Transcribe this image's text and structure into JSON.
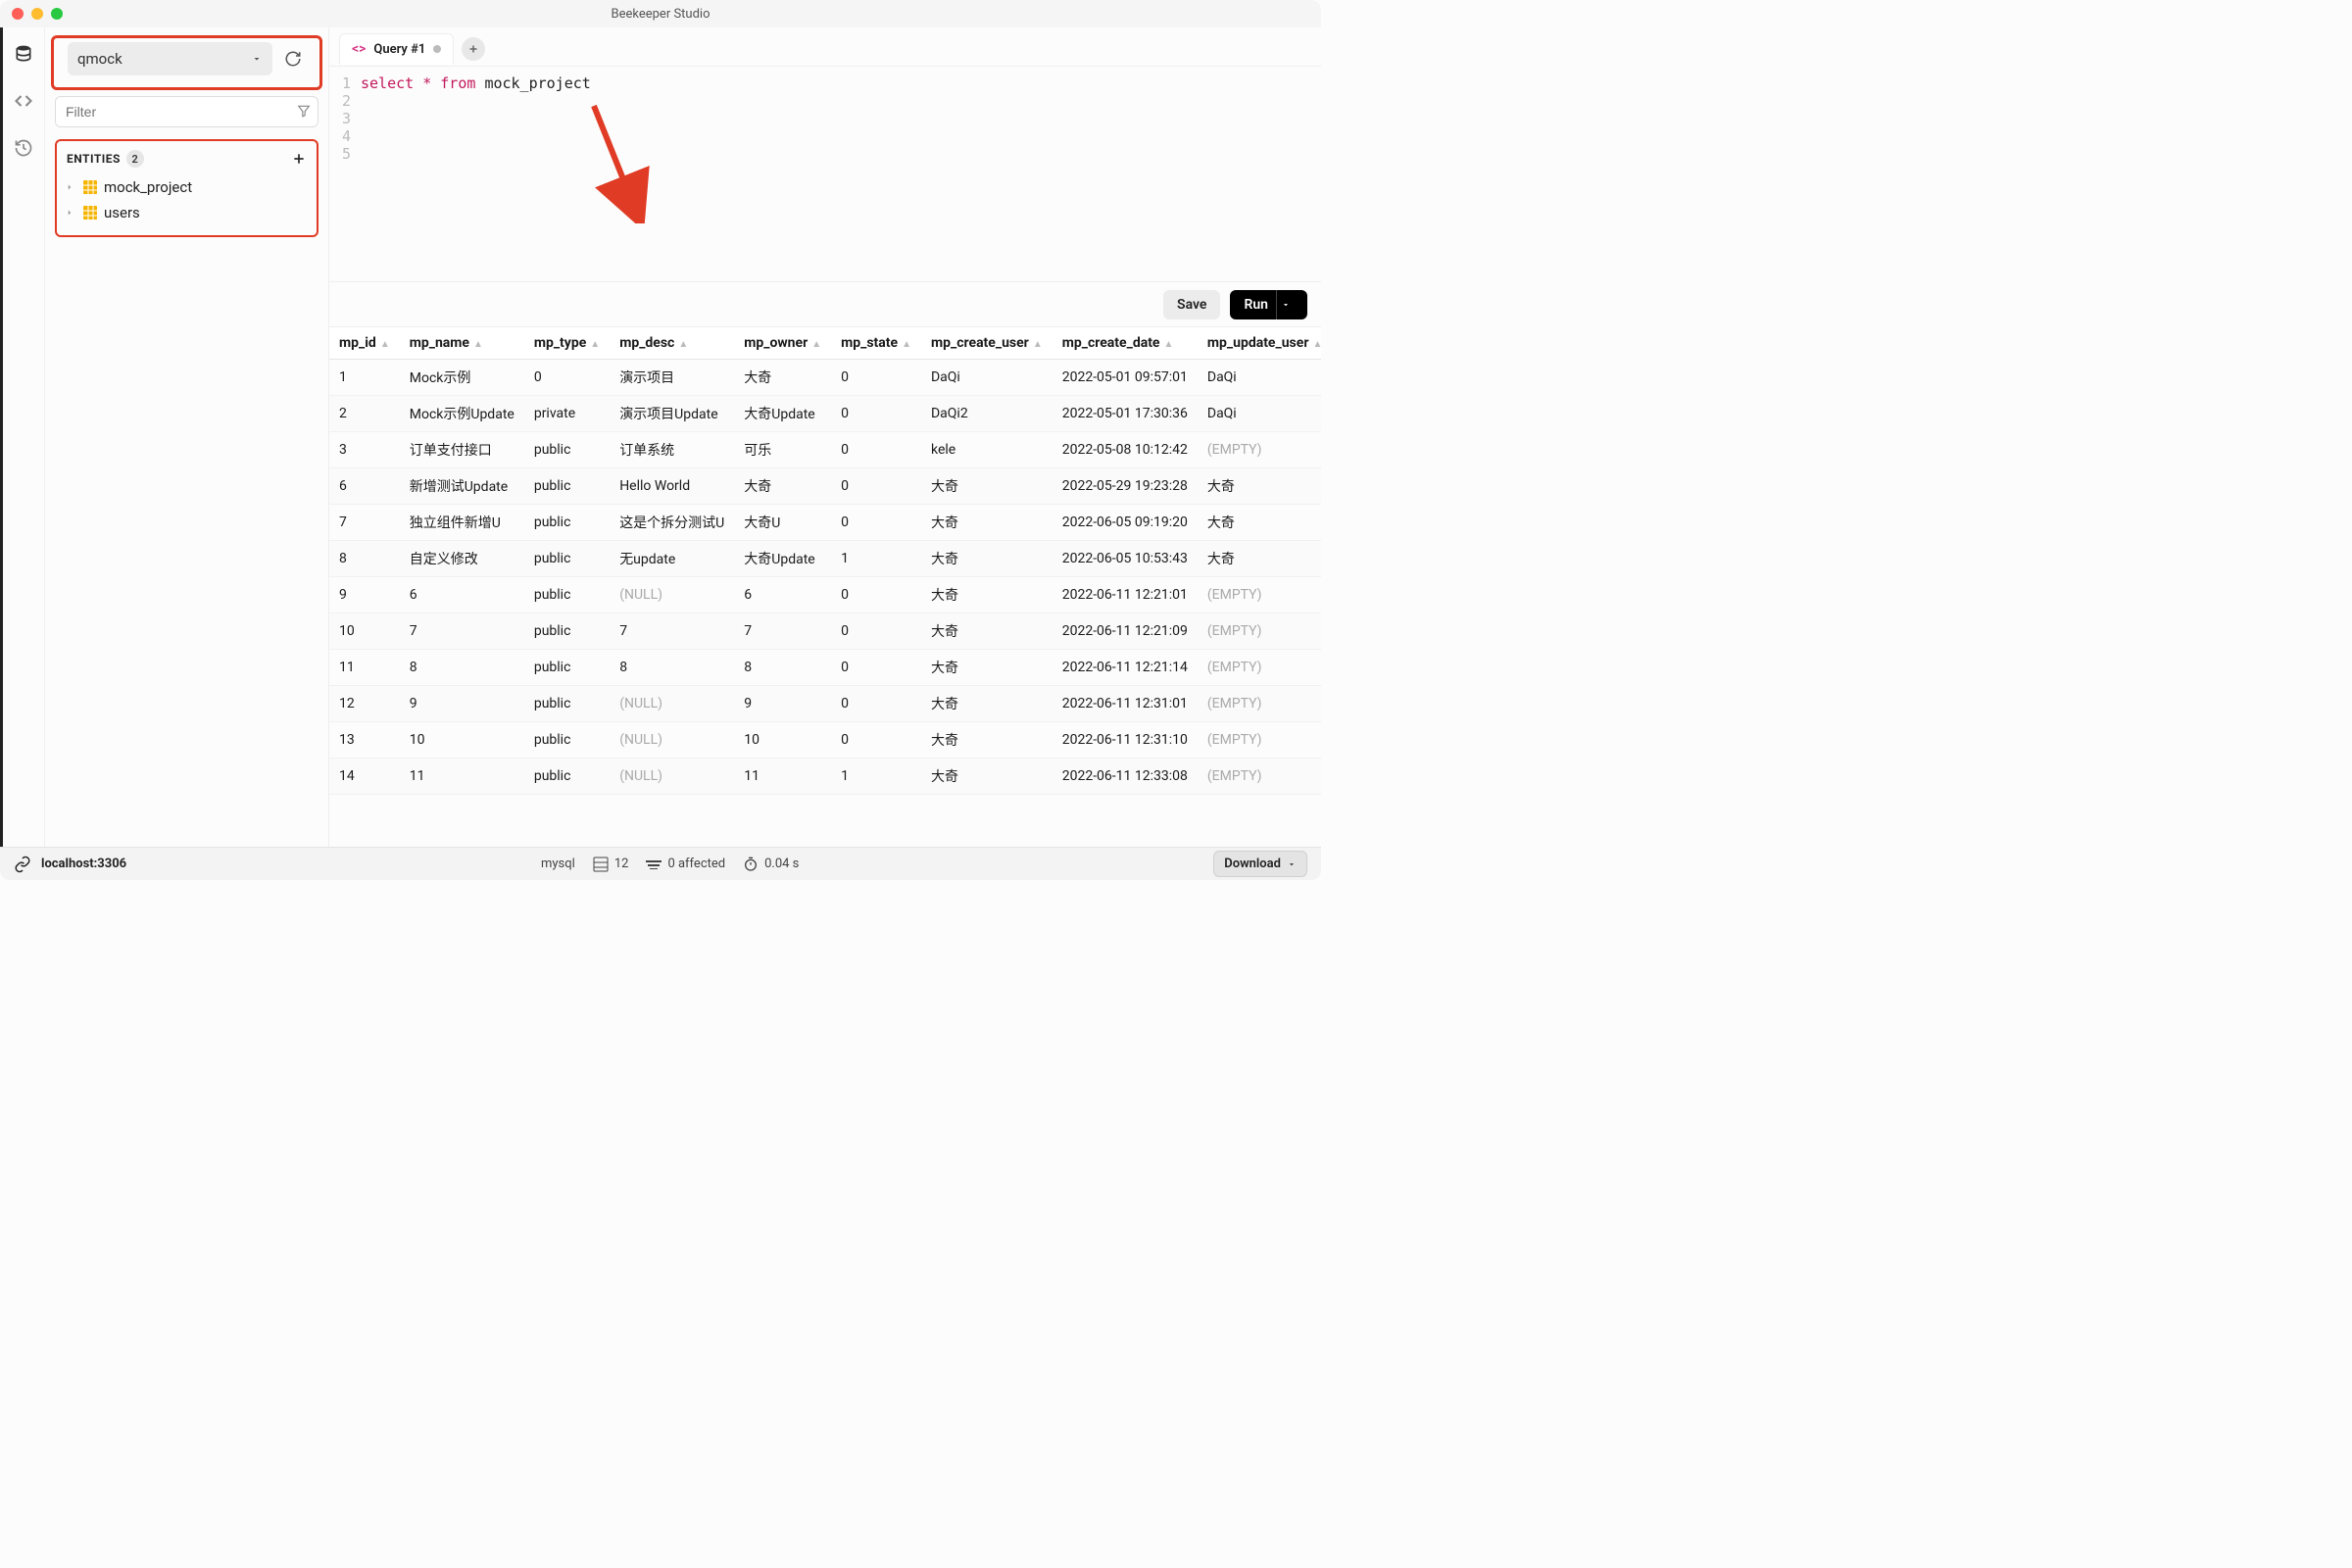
{
  "window": {
    "title": "Beekeeper Studio"
  },
  "sidebar": {
    "database_selected": "qmock",
    "filter_placeholder": "Filter",
    "entities_label": "ENTITIES",
    "entities_count": "2",
    "entities": [
      {
        "name": "mock_project"
      },
      {
        "name": "users"
      }
    ]
  },
  "tabs": {
    "active": {
      "label": "Query #1"
    }
  },
  "editor": {
    "lines": [
      "1",
      "2",
      "3",
      "4",
      "5"
    ],
    "sql_tokens": {
      "select": "select",
      "star": "*",
      "from": "from",
      "ident": "mock_project"
    }
  },
  "toolbar": {
    "save_label": "Save",
    "run_label": "Run"
  },
  "results": {
    "columns": [
      "mp_id",
      "mp_name",
      "mp_type",
      "mp_desc",
      "mp_owner",
      "mp_state",
      "mp_create_user",
      "mp_create_date",
      "mp_update_user"
    ],
    "rows": [
      [
        "1",
        "Mock示例",
        "0",
        "演示项目",
        "大奇",
        "0",
        "DaQi",
        "2022-05-01 09:57:01",
        "DaQi"
      ],
      [
        "2",
        "Mock示例Update",
        "private",
        "演示项目Update",
        "大奇Update",
        "0",
        "DaQi2",
        "2022-05-01 17:30:36",
        "DaQi"
      ],
      [
        "3",
        "订单支付接口",
        "public",
        "订单系统",
        "可乐",
        "0",
        "kele",
        "2022-05-08 10:12:42",
        "(EMPTY)"
      ],
      [
        "6",
        "新增测试Update",
        "public",
        "Hello World",
        "大奇",
        "0",
        "大奇",
        "2022-05-29 19:23:28",
        "大奇"
      ],
      [
        "7",
        "独立组件新增U",
        "public",
        "这是个拆分测试U",
        "大奇U",
        "0",
        "大奇",
        "2022-06-05 09:19:20",
        "大奇"
      ],
      [
        "8",
        "自定义修改",
        "public",
        "无update",
        "大奇Update",
        "1",
        "大奇",
        "2022-06-05 10:53:43",
        "大奇"
      ],
      [
        "9",
        "6",
        "public",
        "(NULL)",
        "6",
        "0",
        "大奇",
        "2022-06-11 12:21:01",
        "(EMPTY)"
      ],
      [
        "10",
        "7",
        "public",
        "7",
        "7",
        "0",
        "大奇",
        "2022-06-11 12:21:09",
        "(EMPTY)"
      ],
      [
        "11",
        "8",
        "public",
        "8",
        "8",
        "0",
        "大奇",
        "2022-06-11 12:21:14",
        "(EMPTY)"
      ],
      [
        "12",
        "9",
        "public",
        "(NULL)",
        "9",
        "0",
        "大奇",
        "2022-06-11 12:31:01",
        "(EMPTY)"
      ],
      [
        "13",
        "10",
        "public",
        "(NULL)",
        "10",
        "0",
        "大奇",
        "2022-06-11 12:31:10",
        "(EMPTY)"
      ],
      [
        "14",
        "11",
        "public",
        "(NULL)",
        "11",
        "1",
        "大奇",
        "2022-06-11 12:33:08",
        "(EMPTY)"
      ]
    ]
  },
  "statusbar": {
    "connection": "localhost:3306",
    "dialect": "mysql",
    "row_count": "12",
    "affected_label": "0 affected",
    "elapsed": "0.04 s",
    "download_label": "Download"
  }
}
